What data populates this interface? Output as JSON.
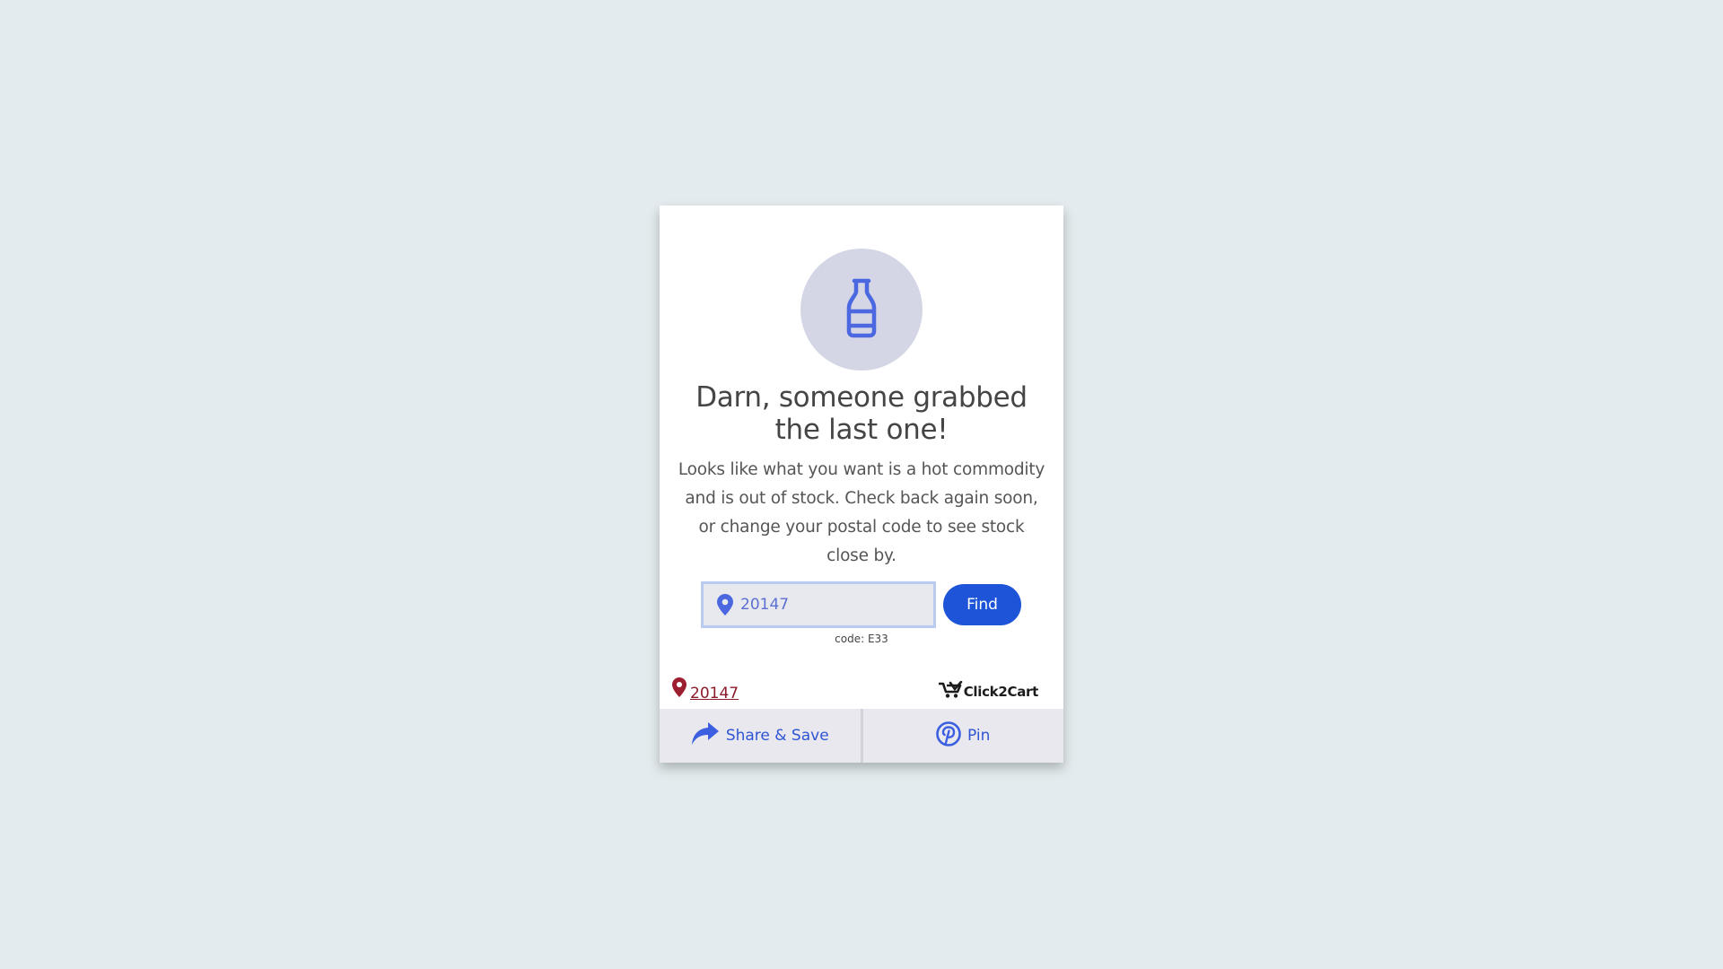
{
  "hero": {
    "icon": "bottle-icon",
    "icon_color": "#4c68e0",
    "circle_color": "#d4d6e6"
  },
  "title": "Darn, someone grabbed the last one!",
  "description": "Looks like what you want is a hot commodity and is out of stock. Check back again soon, or change your postal code to see stock close by.",
  "search": {
    "postal_value": "20147",
    "pin_icon": "map-pin-icon",
    "find_label": "Find",
    "code_note": "code: E33"
  },
  "location": {
    "icon": "map-marker-icon",
    "postal_link": "20147",
    "color": "#8b1a2b"
  },
  "brand": {
    "name": "Click2Cart",
    "logo_icon": "cart-logo-icon"
  },
  "footer": {
    "share_icon": "share-arrow-icon",
    "share_label": "Share & Save",
    "pin_icon": "pinterest-icon",
    "pin_label": "Pin"
  },
  "colors": {
    "background": "#e3ebee",
    "accent": "#1e54d8",
    "link_blue": "#2f55d4"
  }
}
